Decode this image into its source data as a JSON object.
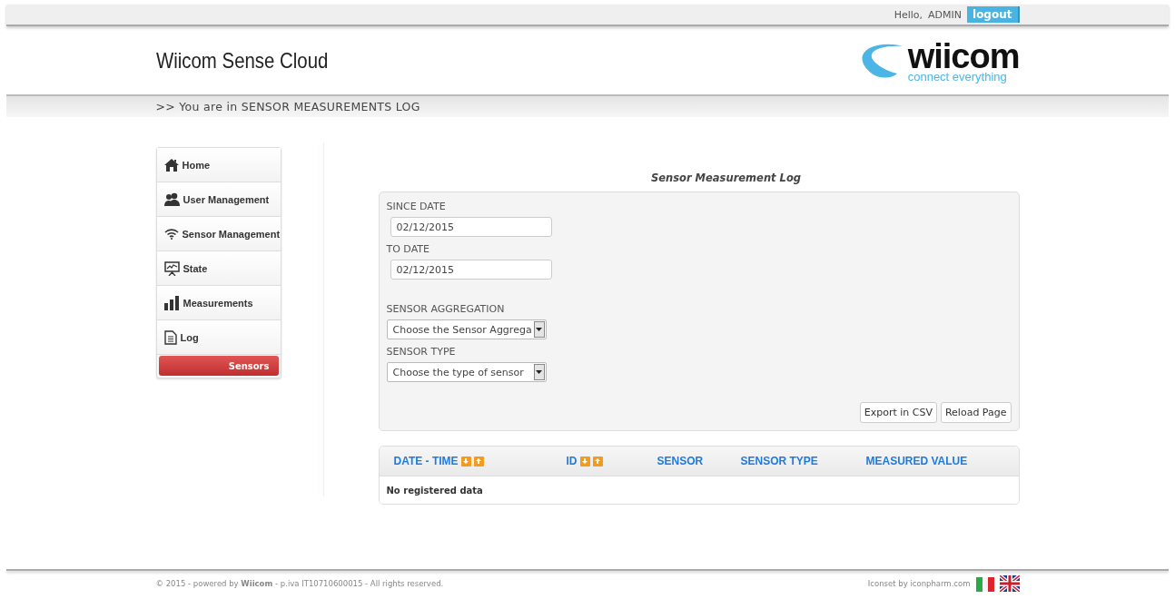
{
  "top_bar": {
    "greeting": "Hello,",
    "user": "ADMIN",
    "logout": "logout"
  },
  "header": {
    "title": "Wiicom Sense Cloud",
    "logo_name": "wiicom",
    "logo_tagline": "connect everything"
  },
  "breadcrumb": ">> You are in SENSOR MEASUREMENTS LOG",
  "sidebar": {
    "items": [
      {
        "label": "Home",
        "kind": "item",
        "selected": false
      },
      {
        "label": "User Management",
        "kind": "item",
        "selected": false
      },
      {
        "label": "Sensor Management",
        "kind": "item",
        "selected": false
      },
      {
        "label": "State",
        "kind": "item",
        "selected": false
      },
      {
        "label": "Measurements",
        "kind": "item",
        "selected": false
      },
      {
        "label": "Log",
        "kind": "item",
        "selected": false
      },
      {
        "label": "Sensors",
        "kind": "sub",
        "selected": true
      }
    ]
  },
  "panel": {
    "title": "Sensor Measurement Log",
    "fields": [
      {
        "kind": "date",
        "label": "SINCE DATE",
        "value": "02/12/2015"
      },
      {
        "kind": "date",
        "label": "TO DATE",
        "value": "02/12/2015"
      },
      {
        "kind": "select",
        "label": "SENSOR AGGREGATION",
        "value": "Choose the Sensor Aggrega"
      },
      {
        "kind": "select",
        "label": "SENSOR TYPE",
        "value": "Choose the type of sensor"
      }
    ],
    "buttons": [
      "Export in CSV",
      "Reload Page"
    ]
  },
  "table": {
    "columns": [
      {
        "label": "DATE - TIME",
        "sortable": true
      },
      {
        "label": "ID",
        "sortable": true
      },
      {
        "label": "SENSOR",
        "sortable": false
      },
      {
        "label": "SENSOR TYPE",
        "sortable": false
      },
      {
        "label": "MEASURED VALUE",
        "sortable": false
      }
    ],
    "empty_message": "No registered data"
  },
  "footer": {
    "copyright": "© 2015 - powered by **Wiicom** - p.iva IT10710600015 - All rights reserved.",
    "credit": "Iconset by iconpharm.com"
  }
}
